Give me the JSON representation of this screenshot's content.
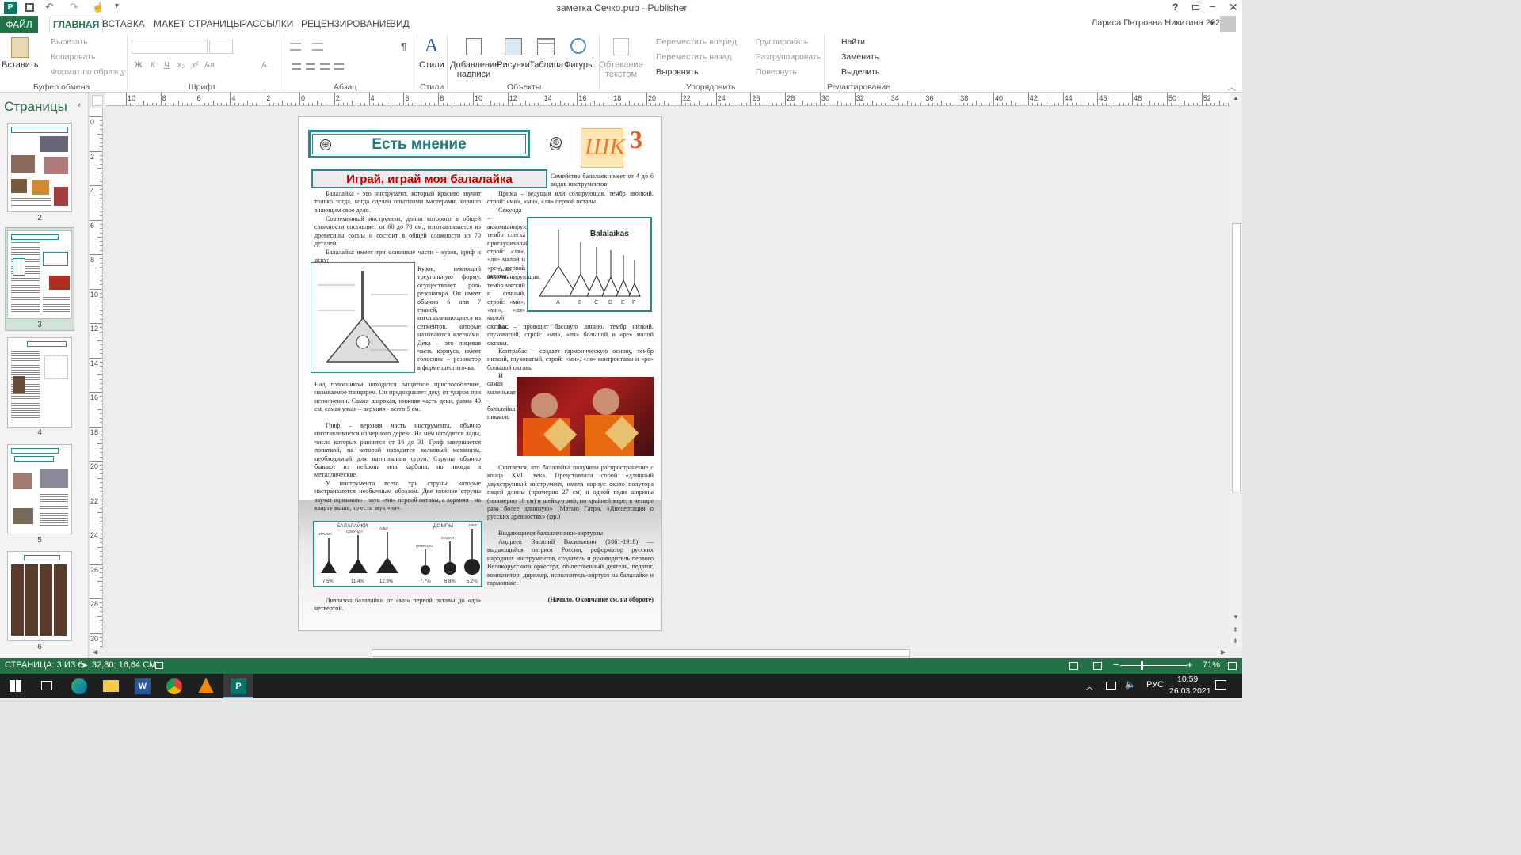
{
  "app": {
    "title": "заметка Сечко.pub - Publisher",
    "user": "Лариса Петровна Никитина 2020",
    "help": "?"
  },
  "tabs": [
    "ФАЙЛ",
    "ГЛАВНАЯ",
    "ВСТАВКА",
    "МАКЕТ СТРАНИЦЫ",
    "РАССЫЛКИ",
    "РЕЦЕНЗИРОВАНИЕ",
    "ВИД"
  ],
  "ribbon": {
    "clipboard": {
      "paste": "Вставить",
      "cut": "Вырезать",
      "copy": "Копировать",
      "format": "Формат по образцу",
      "group": "Буфер обмена"
    },
    "font": {
      "group": "Шрифт",
      "bold": "Ж",
      "italic": "К",
      "underline": "Ч",
      "sub": "x₂",
      "sup": "x²",
      "case": "Aa",
      "color": "A"
    },
    "paragraph": {
      "group": "Абзац",
      "pilcrow": "¶"
    },
    "styles": {
      "label": "Стили",
      "group": "Стили"
    },
    "objects": {
      "textbox": "Добавление надписи",
      "pictures": "Рисунки",
      "table": "Таблица",
      "shapes": "Фигуры",
      "group": "Объекты"
    },
    "arrange": {
      "wrap": "Обтекание текстом",
      "forward": "Переместить вперед",
      "backward": "Переместить назад",
      "align": "Выровнять",
      "group_btn": "Группировать",
      "ungroup": "Разгруппировать",
      "rotate": "Повернуть",
      "group": "Упорядочить"
    },
    "editing": {
      "find": "Найти",
      "replace": "Заменить",
      "select": "Выделить",
      "group": "Редактирование"
    }
  },
  "pages": {
    "title": "Страницы",
    "items": [
      "2",
      "3",
      "4",
      "5",
      "6"
    ],
    "selected": "3"
  },
  "ruler": {
    "h": [
      "10",
      "8",
      "6",
      "4",
      "2",
      "0",
      "2",
      "4",
      "6",
      "8",
      "10",
      "12",
      "14",
      "16",
      "18",
      "20",
      "22",
      "24",
      "26",
      "28",
      "30",
      "32",
      "34",
      "36",
      "38",
      "40",
      "42",
      "44",
      "46",
      "48",
      "50",
      "52"
    ],
    "v": [
      "0",
      "2",
      "4",
      "6",
      "8",
      "10",
      "12",
      "14",
      "16",
      "18",
      "20",
      "22",
      "24",
      "26",
      "28",
      "30"
    ]
  },
  "doc": {
    "banner": "Есть мнение",
    "logo": "ШК",
    "page_no": "3",
    "headline": "Играй, играй моя балалайка",
    "intro_right": "Семейство балалаек имеет от 4 до 6 видов инструментов:",
    "left_p1": "Балалайка - это инструмент, который красиво звучит только тогда, когда сделан опытными мастерами, хорошо знающим свое дело.",
    "left_p2": "Современный инструмент, длина которого в общей сложности составляет от 60 до 70 см., изготавливается из древесины сосны и состоит в общей сложности из 70 деталей.",
    "left_p3": "Балалайка имеет три основные части - кузов, гриф и деку:",
    "left_wrap": "Кузов, имеющий треугольную форму, осуществляет роль резонатора. Он имеет обычно 6 или 7 граней, изготавливающиеся из сегментов, которые называются клепками. Дека – это лицевая часть корпуса, имеет голосник – резонатор в форме шеститочка.",
    "left_p4": "Над голосником находится защитное приспособление, называемое панцирем. Он предохраняет деку от ударов при исполнении. Самая широкая, нижняя часть деки, равна 40 см, самая узкая – верхняя - всего 5 см.",
    "left_p5": "Гриф – верхняя часть инструмента, обычно изготавливается из черного дерева. На нем находятся лады, число которых равнится от 16 до 31. Гриф завершается лопаткой, на которой находится колковый механизм, необходимый для натягивания струн. Струны обычно бывают из нейлона или карбона, но иногда и металлические.",
    "left_p6": "У инструмента всего три струны, которые настраиваются необычным образом. Две нижние струны звучат одинаково - звук «ми» первой октавы, а верхняя - на кварту выше, то есть звук «ля».",
    "left_p7": "Диапазон балалайки от «ми» первой октавы до «до» четвертой.",
    "right_p1": "Прима – ведущая или солирующая, тембр звонкий, строй: «ми», «ми», «ля» первой октавы.",
    "right_p2": "Секунда – аккомпанирующая, тембр слегка приглушенный, строй: «ля», «ля» малой и «ре» первой октавы.",
    "right_p3": "Альт – аккомпанирующая, тембр мягкий и сочный, строй: «ми», «ми», «ля» малой октавы.",
    "right_p4": "Бас – проводит басовую линию, тембр низкий, глуховатый, строй: «ми», «ля» большой и «ре» малой октавы.",
    "right_p5": "Контрабас – создает гармоническую основу, тембр низкий, глуховатый, строй: «ми», «ля» контроктавы и «ре» большой октавы",
    "right_p6": "И самая маленькая – балалайка пикколо",
    "right_p7": "Считается, что балалайка получила распространение с конца XVII века. Представляла собой «длинный двухструнный инструмент, имела корпус около полутора пядей длины (примерно 27 см) и одной пяди ширины (примерно 18 см) и шейку-гриф, по крайней мере, в четыре раза более длинную» (Мэтью Гатри, «Диссертация о русских древностях» (фр.)",
    "right_p8": "Выдающиеся балалаечники-виртуозы",
    "right_p9": "Андреев Василий Васильевич (1861-1918) — выдающийся патриот России, реформатор русских народных инструментов, создатель и руководитель первого Великорусского оркестра, общественный деятель, педагог, композитор, дирижер, исполнитель-виртуоз на балалайке и гармонике.",
    "right_p10": "(Начало. Окончание см. на обороте)",
    "fig_title": "Balalaikas",
    "fig_letters": [
      "A",
      "B",
      "C",
      "D",
      "E",
      "F"
    ],
    "fig2_labels": {
      "balalaiki": "БАЛАЛАЙКИ",
      "domry": "ДОМРЫ",
      "prima": "ПРИМА",
      "sekunda": "СЕКУНДА",
      "alt": "АЛЬТ",
      "pikkolo": "ПИККОЛО",
      "malaya": "МАЛАЯ",
      "alt2": "АЛЬТ"
    },
    "fig2_pcts": [
      "7.5%",
      "11.4%",
      "12.9%",
      "7.7%",
      "6.8%",
      "5.2%"
    ]
  },
  "status": {
    "page": "СТРАНИЦА: 3 ИЗ 6",
    "coords": "32,80; 16,64 СМ",
    "zoom": "71%",
    "zoom_minus": "−",
    "zoom_plus": "+"
  },
  "taskbar": {
    "lang": "РУС",
    "time": "10:59",
    "date": "26.03.2021"
  },
  "colors": {
    "accent": "#217346",
    "publisher": "#077568",
    "teal": "#2a8a8a",
    "headline_red": "#c00000"
  }
}
